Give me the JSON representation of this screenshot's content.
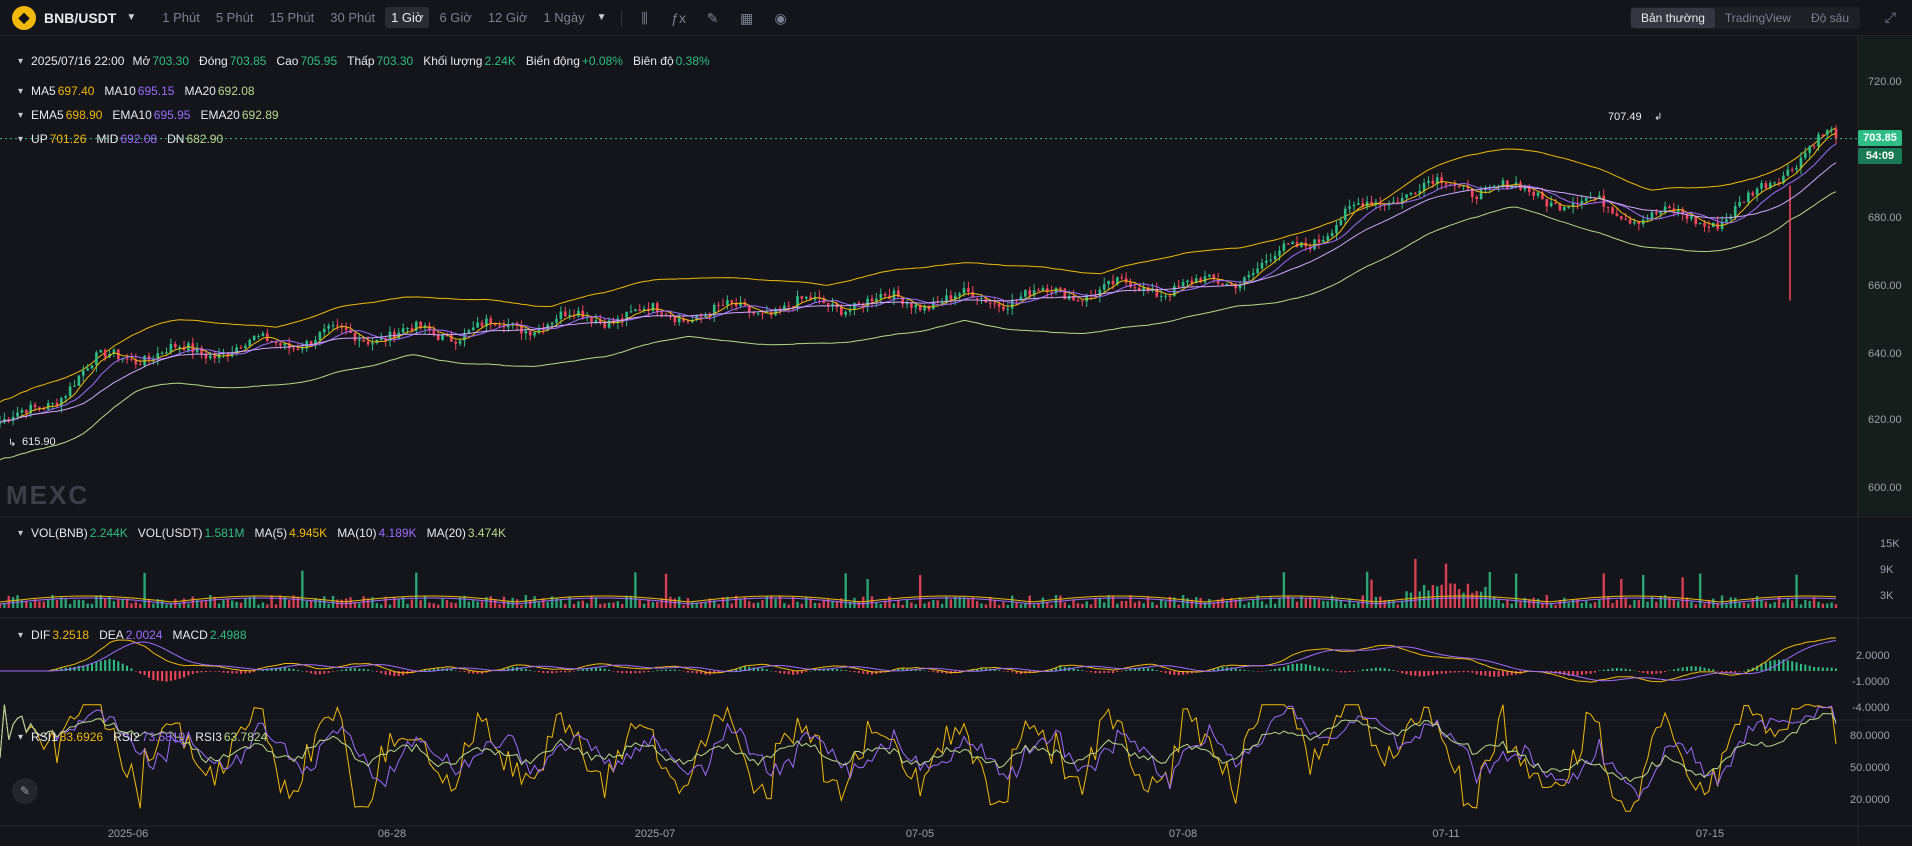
{
  "header": {
    "pair": "BNB/USDT",
    "intervals": [
      "1 Phút",
      "5 Phút",
      "15 Phút",
      "30 Phút",
      "1 Giờ",
      "6 Giờ",
      "12 Giờ",
      "1 Ngày"
    ],
    "active_interval": "1 Giờ",
    "views": [
      "Bản thường",
      "TradingView",
      "Độ sâu"
    ],
    "active_view": "Bản thường"
  },
  "ohlc": {
    "date": "2025/07/16 22:00",
    "open_label": "Mở",
    "open": "703.30",
    "close_label": "Đóng",
    "close": "703.85",
    "high_label": "Cao",
    "high": "705.95",
    "low_label": "Thấp",
    "low": "703.30",
    "volume_label": "Khối lượng",
    "volume": "2.24K",
    "change_label": "Biến động",
    "change": "+0.08%",
    "amplitude_label": "Biên độ",
    "amplitude": "0.38%"
  },
  "ma": {
    "ma5_label": "MA5",
    "ma5": "697.40",
    "ma10_label": "MA10",
    "ma10": "695.15",
    "ma20_label": "MA20",
    "ma20": "692.08"
  },
  "ema": {
    "ema5_label": "EMA5",
    "ema5": "698.90",
    "ema10_label": "EMA10",
    "ema10": "695.95",
    "ema20_label": "EMA20",
    "ema20": "692.89"
  },
  "boll": {
    "up_label": "UP",
    "up": "701.26",
    "mid_label": "MID",
    "mid": "692.08",
    "dn_label": "DN",
    "dn": "682.90"
  },
  "vol": {
    "vol_bnb_label": "VOL(BNB)",
    "vol_bnb": "2.244K",
    "vol_usdt_label": "VOL(USDT)",
    "vol_usdt": "1.581M",
    "ma5_label": "MA(5)",
    "ma5": "4.945K",
    "ma10_label": "MA(10)",
    "ma10": "4.189K",
    "ma20_label": "MA(20)",
    "ma20": "3.474K"
  },
  "macd": {
    "dif_label": "DIF",
    "dif": "3.2518",
    "dea_label": "DEA",
    "dea": "2.0024",
    "macd_label": "MACD",
    "macd": "2.4988"
  },
  "rsi": {
    "rsi1_label": "RSI1",
    "rsi1": "83.6926",
    "rsi2_label": "RSI2",
    "rsi2": "73.5819",
    "rsi3_label": "RSI3",
    "rsi3": "63.7824"
  },
  "price_axis": [
    "720.00",
    "700.00",
    "680.00",
    "660.00",
    "640.00",
    "620.00",
    "600.00"
  ],
  "vol_axis": [
    "15K",
    "9K",
    "3K"
  ],
  "macd_axis": [
    "2.0000",
    "-1.0000",
    "-4.0000"
  ],
  "rsi_axis": [
    "80.0000",
    "50.0000",
    "20.0000"
  ],
  "x_axis": [
    "2025-06",
    "06-28",
    "2025-07",
    "07-05",
    "07-08",
    "07-11",
    "07-15"
  ],
  "last_price": "703.85",
  "countdown": "54:09",
  "annotations": {
    "high": "707.49",
    "low": "615.90"
  },
  "watermark": "MEXC",
  "colors": {
    "up": "#2ebd85",
    "down": "#f6465d",
    "ma5": "#f0b90b",
    "ma10": "#9d6bff",
    "ma20": "#b8d98a",
    "background": "#14151a"
  },
  "chart_data": {
    "type": "candlestick",
    "interval": "1h",
    "ylim": [
      595,
      725
    ],
    "grid": false,
    "x_ticks": [
      "2025-06",
      "06-28",
      "2025-07",
      "07-05",
      "07-08",
      "07-11",
      "07-15"
    ],
    "key_points": [
      {
        "x": "start",
        "close": 620
      },
      {
        "x": "2025-06",
        "close": 640
      },
      {
        "x": "06-28",
        "close": 646
      },
      {
        "x": "2025-07",
        "close": 652
      },
      {
        "x": "07-05",
        "close": 656
      },
      {
        "x": "07-08",
        "close": 660
      },
      {
        "x": "07-11",
        "close": 690
      },
      {
        "x": "07-15",
        "close": 680
      },
      {
        "x": "end",
        "close": 703.85
      }
    ],
    "high_mark": 707.49,
    "low_mark": 615.9,
    "last": 703.85
  }
}
